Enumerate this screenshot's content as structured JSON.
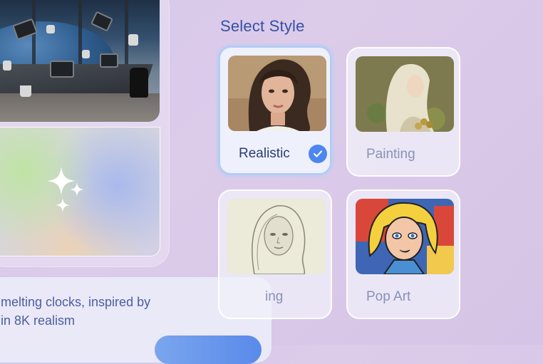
{
  "select_style": {
    "title": "Select Style",
    "options": [
      {
        "label": "Realistic",
        "selected": true,
        "thumb": "portrait-photo"
      },
      {
        "label": "Painting",
        "selected": false,
        "thumb": "classical-painting"
      },
      {
        "label": "ing",
        "selected": false,
        "thumb": "pencil-sketch"
      },
      {
        "label": "Pop Art",
        "selected": false,
        "thumb": "pop-art-comic"
      }
    ]
  },
  "prompt": {
    "line1": "melting clocks, inspired by",
    "line2": "in 8K realism"
  },
  "icons": {
    "sparkle": "sparkle-icon",
    "check": "check-icon"
  },
  "colors": {
    "accent": "#4d86ee",
    "title": "#3450a4",
    "background": "#d8c8ea"
  }
}
